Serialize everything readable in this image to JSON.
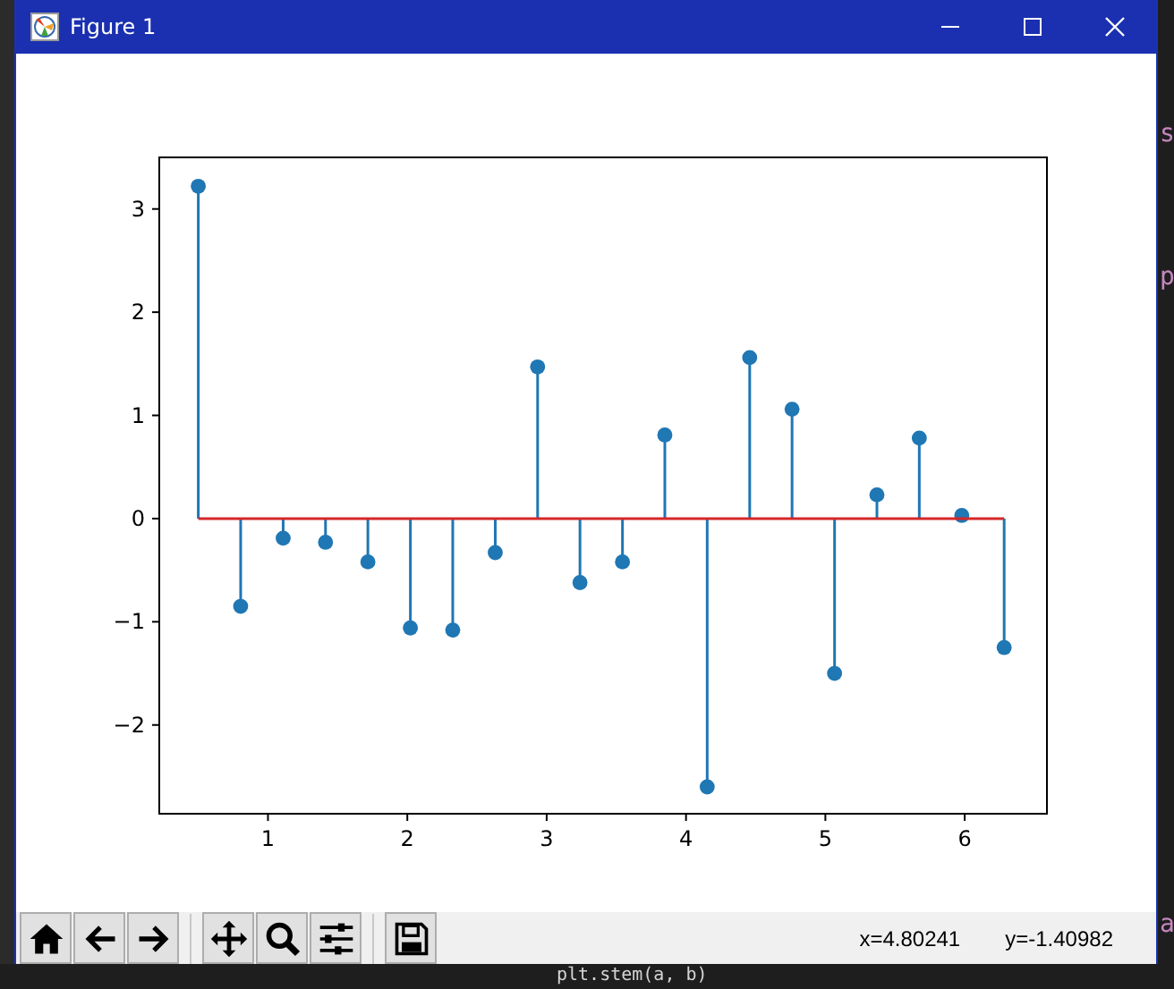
{
  "window": {
    "title": "Figure 1"
  },
  "plot": {
    "chart_data": {
      "type": "scatter",
      "x": [
        0.5,
        0.804,
        1.109,
        1.413,
        1.717,
        2.022,
        2.326,
        2.631,
        2.935,
        3.239,
        3.544,
        3.848,
        4.152,
        4.457,
        4.761,
        5.066,
        5.37,
        5.674,
        5.979,
        6.283
      ],
      "series": [
        {
          "color": "#1f77b4",
          "marker": "o",
          "values": [
            3.22,
            -0.85,
            -0.19,
            -0.23,
            -0.42,
            -1.06,
            -1.08,
            -0.33,
            1.47,
            -0.62,
            -0.42,
            0.81,
            -2.6,
            1.56,
            1.06,
            -1.5,
            0.23,
            0.78,
            0.03,
            -1.25
          ]
        }
      ],
      "ref_lines": [
        {
          "axis": "y",
          "value": 0,
          "color": "#d62728"
        }
      ],
      "xlim": [
        0.22,
        6.59
      ],
      "ylim": [
        -2.86,
        3.5
      ],
      "xticks": [
        1,
        2,
        3,
        4,
        5,
        6
      ],
      "yticks": [
        {
          "value": -2,
          "label": "−2"
        },
        {
          "value": -1,
          "label": "−1"
        },
        0,
        1,
        2,
        3
      ]
    }
  },
  "toolbar": {
    "buttons": [
      {
        "kind": "home"
      },
      {
        "kind": "back"
      },
      {
        "kind": "forward"
      },
      {
        "kind": "sep"
      },
      {
        "kind": "pan"
      },
      {
        "kind": "zoom"
      },
      {
        "kind": "configure"
      },
      {
        "kind": "sep"
      },
      {
        "kind": "save"
      }
    ],
    "x_readout": "x=4.80241",
    "y_readout": "y=-1.40982"
  },
  "background_code": {
    "right_fragments": [
      "s",
      "p",
      "a"
    ],
    "bottom_line": "plt.stem(a, b)"
  }
}
